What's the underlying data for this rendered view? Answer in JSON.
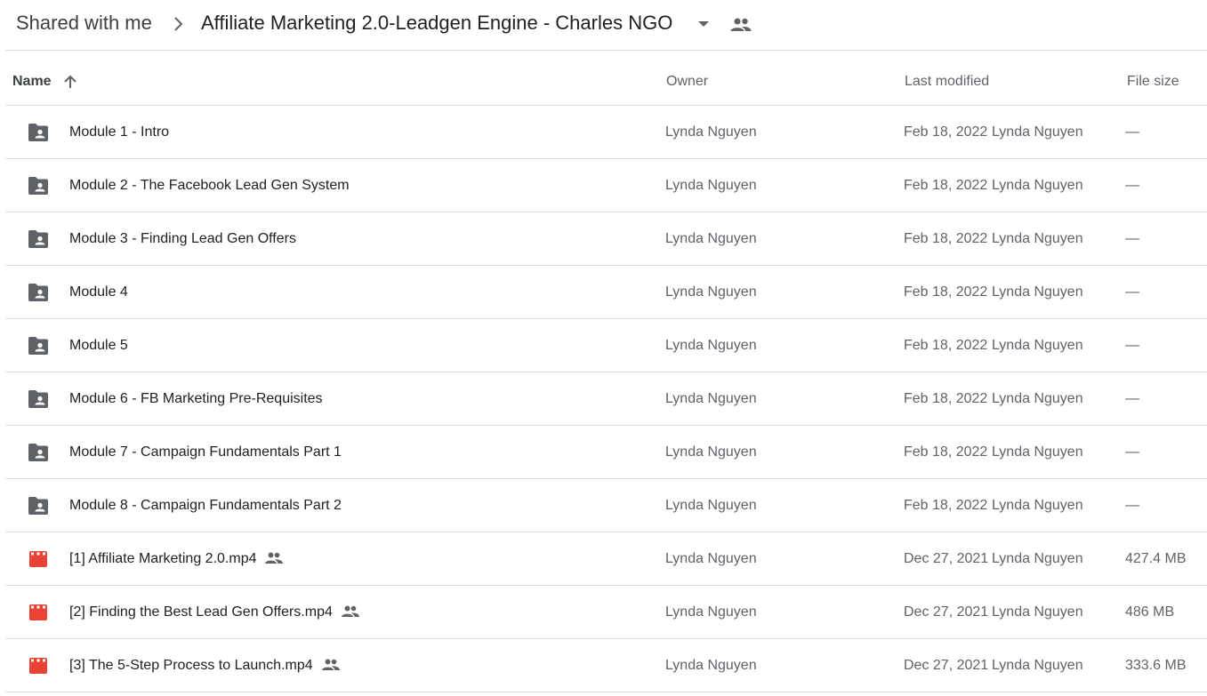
{
  "breadcrumb": {
    "parent": "Shared with me",
    "current": "Affiliate Marketing 2.0-Leadgen Engine - Charles NGO"
  },
  "icons": {
    "separator": "chevron-right-icon",
    "dropdown": "caret-down-icon",
    "shared": "people-icon",
    "sort": "arrow-up-icon",
    "folder": "shared-folder-icon",
    "video": "video-file-icon"
  },
  "colors": {
    "folder_icon": "#5f6368",
    "video_icon": "#ea4335",
    "divider": "#dadce0"
  },
  "columns": {
    "name": "Name",
    "owner": "Owner",
    "last_modified": "Last modified",
    "file_size": "File size"
  },
  "rows": [
    {
      "type": "folder",
      "name": "Module 1 - Intro",
      "shared": false,
      "owner": "Lynda Nguyen",
      "modified": "Feb 18, 2022",
      "modified_by": "Lynda Nguyen",
      "size": "—"
    },
    {
      "type": "folder",
      "name": "Module 2 - The Facebook Lead Gen System",
      "shared": false,
      "owner": "Lynda Nguyen",
      "modified": "Feb 18, 2022",
      "modified_by": "Lynda Nguyen",
      "size": "—"
    },
    {
      "type": "folder",
      "name": "Module 3 - Finding Lead Gen Offers",
      "shared": false,
      "owner": "Lynda Nguyen",
      "modified": "Feb 18, 2022",
      "modified_by": "Lynda Nguyen",
      "size": "—"
    },
    {
      "type": "folder",
      "name": "Module 4",
      "shared": false,
      "owner": "Lynda Nguyen",
      "modified": "Feb 18, 2022",
      "modified_by": "Lynda Nguyen",
      "size": "—"
    },
    {
      "type": "folder",
      "name": "Module 5",
      "shared": false,
      "owner": "Lynda Nguyen",
      "modified": "Feb 18, 2022",
      "modified_by": "Lynda Nguyen",
      "size": "—"
    },
    {
      "type": "folder",
      "name": "Module 6 - FB Marketing Pre-Requisites",
      "shared": false,
      "owner": "Lynda Nguyen",
      "modified": "Feb 18, 2022",
      "modified_by": "Lynda Nguyen",
      "size": "—"
    },
    {
      "type": "folder",
      "name": "Module 7 - Campaign Fundamentals Part 1",
      "shared": false,
      "owner": "Lynda Nguyen",
      "modified": "Feb 18, 2022",
      "modified_by": "Lynda Nguyen",
      "size": "—"
    },
    {
      "type": "folder",
      "name": "Module 8 - Campaign Fundamentals Part 2",
      "shared": false,
      "owner": "Lynda Nguyen",
      "modified": "Feb 18, 2022",
      "modified_by": "Lynda Nguyen",
      "size": "—"
    },
    {
      "type": "video",
      "name": "[1] Affiliate Marketing 2.0.mp4",
      "shared": true,
      "owner": "Lynda Nguyen",
      "modified": "Dec 27, 2021",
      "modified_by": "Lynda Nguyen",
      "size": "427.4 MB"
    },
    {
      "type": "video",
      "name": "[2] Finding the Best Lead Gen Offers.mp4",
      "shared": true,
      "owner": "Lynda Nguyen",
      "modified": "Dec 27, 2021",
      "modified_by": "Lynda Nguyen",
      "size": "486 MB"
    },
    {
      "type": "video",
      "name": "[3] The 5-Step Process to Launch.mp4",
      "shared": true,
      "owner": "Lynda Nguyen",
      "modified": "Dec 27, 2021",
      "modified_by": "Lynda Nguyen",
      "size": "333.6 MB"
    }
  ]
}
